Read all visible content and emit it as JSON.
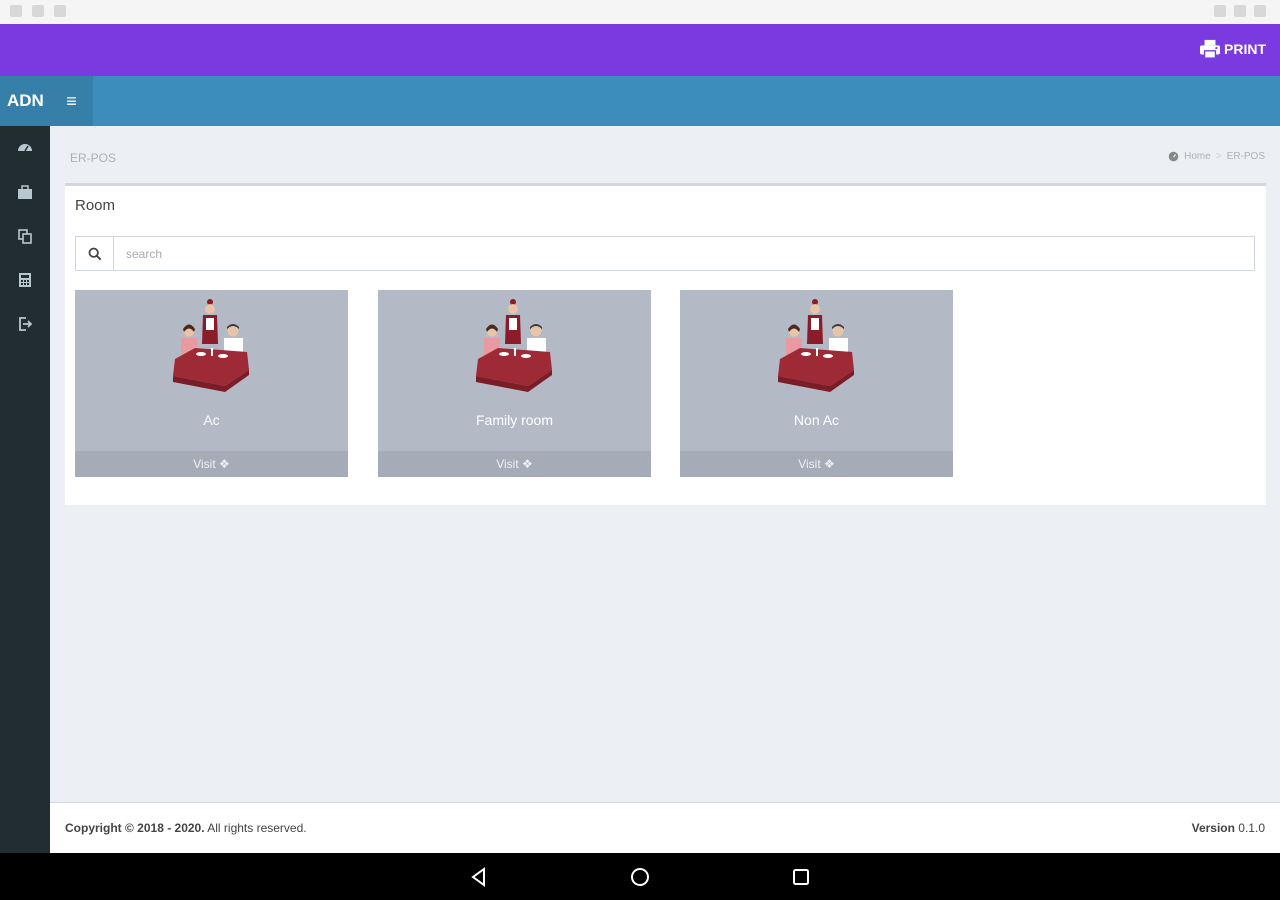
{
  "app": {
    "brand": "ADN",
    "print_label": "PRINT"
  },
  "page": {
    "heading": "ER-POS",
    "breadcrumb": [
      "Home",
      ">",
      "ER-POS"
    ]
  },
  "box": {
    "title": "Room",
    "search_placeholder": "search"
  },
  "rooms": [
    {
      "name": "Ac",
      "action": "Visit"
    },
    {
      "name": "Family room",
      "action": "Visit"
    },
    {
      "name": "Non Ac",
      "action": "Visit"
    }
  ],
  "footer": {
    "copyright_bold": "Copyright © 2018 - 2020.",
    "copyright_rest": " All rights reserved.",
    "version_label": "Version",
    "version_value": " 0.1.0"
  },
  "colors": {
    "purple_bar": "#7a3ae0",
    "header": "#3c8dbc",
    "sidebar": "#222d32",
    "card": "#b4b9c6"
  }
}
